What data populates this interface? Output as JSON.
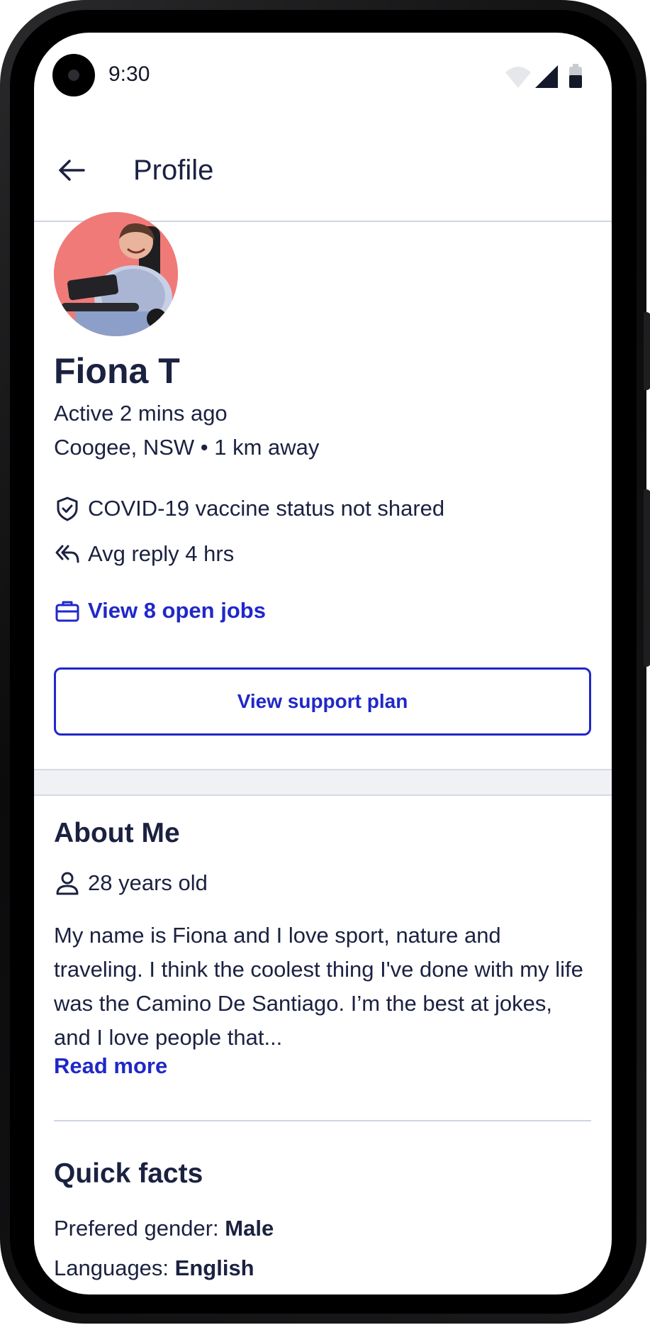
{
  "status_bar": {
    "time": "9:30"
  },
  "app_bar": {
    "title": "Profile"
  },
  "profile": {
    "name": "Fiona T",
    "active": "Active 2 mins ago",
    "location": "Coogee, NSW • 1 km away",
    "vaccine_status": "COVID-19 vaccine status not shared",
    "avg_reply": "Avg reply 4 hrs",
    "open_jobs_link": "View 8 open jobs",
    "support_plan_button": "View support plan"
  },
  "about": {
    "title": "About Me",
    "age": "28 years old",
    "bio": "My name is Fiona and I love sport, nature and traveling. I think the coolest thing I've done with my life was the Camino De Santiago. I’m the best at jokes, and I love people that...",
    "read_more": "Read more"
  },
  "quick_facts": {
    "title": "Quick facts",
    "gender_label": "Prefered gender:",
    "gender_value": "Male",
    "languages_label": "Languages:",
    "languages_value": "English"
  },
  "colors": {
    "accent": "#2028c8",
    "text": "#1b2140",
    "avatar_bg": "#ef7a78"
  }
}
